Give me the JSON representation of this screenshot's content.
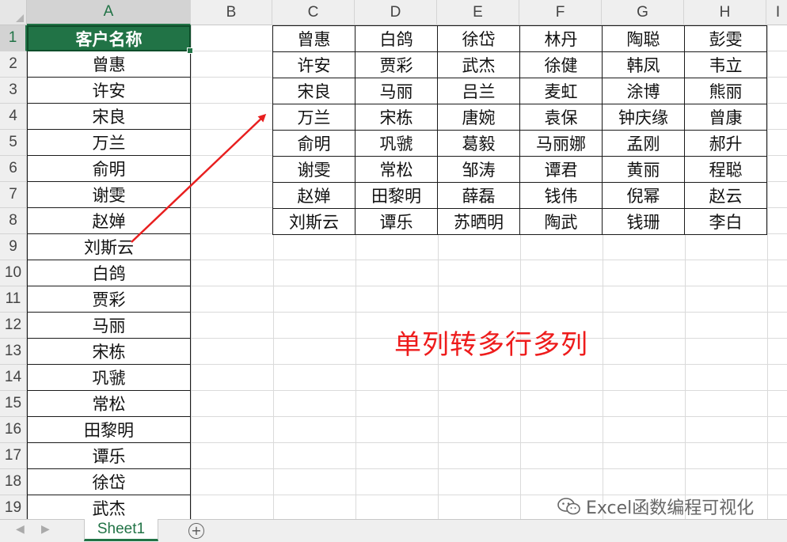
{
  "spreadsheet": {
    "columns": [
      "A",
      "B",
      "C",
      "D",
      "E",
      "F",
      "G",
      "H",
      "I"
    ],
    "rows": [
      "1",
      "2",
      "3",
      "4",
      "5",
      "6",
      "7",
      "8",
      "9",
      "10",
      "11",
      "12",
      "13",
      "14",
      "15",
      "16",
      "17",
      "18",
      "19"
    ],
    "selected_column": "A",
    "selected_row": "1"
  },
  "column_a": {
    "header": "客户名称",
    "values": [
      "曾惠",
      "许安",
      "宋良",
      "万兰",
      "俞明",
      "谢雯",
      "赵婵",
      "刘斯云",
      "白鸽",
      "贾彩",
      "马丽",
      "宋栋",
      "巩虢",
      "常松",
      "田黎明",
      "谭乐",
      "徐岱",
      "武杰"
    ]
  },
  "result_table": {
    "rows": [
      [
        "曾惠",
        "白鸽",
        "徐岱",
        "林丹",
        "陶聪",
        "彭雯"
      ],
      [
        "许安",
        "贾彩",
        "武杰",
        "徐健",
        "韩凤",
        "韦立"
      ],
      [
        "宋良",
        "马丽",
        "吕兰",
        "麦虹",
        "涂博",
        "熊丽"
      ],
      [
        "万兰",
        "宋栋",
        "唐婉",
        "袁保",
        "钟庆缘",
        "曾康"
      ],
      [
        "俞明",
        "巩虢",
        "葛毅",
        "马丽娜",
        "孟刚",
        "郝升"
      ],
      [
        "谢雯",
        "常松",
        "邹涛",
        "谭君",
        "黄丽",
        "程聪"
      ],
      [
        "赵婵",
        "田黎明",
        "薛磊",
        "钱伟",
        "倪幂",
        "赵云"
      ],
      [
        "刘斯云",
        "谭乐",
        "苏晒明",
        "陶武",
        "钱珊",
        "李白"
      ]
    ]
  },
  "annotation": {
    "caption": "单列转多行多列",
    "arrow_color": "#e81f1f"
  },
  "sheet_tabs": {
    "active": "Sheet1",
    "add_symbol": "+",
    "nav_prev": "◀",
    "nav_next": "▶"
  },
  "watermark": {
    "text": "Excel函数编程可视化",
    "icon": "wechat-icon"
  },
  "colors": {
    "accent": "#217346",
    "caption": "#ee1c1c"
  }
}
